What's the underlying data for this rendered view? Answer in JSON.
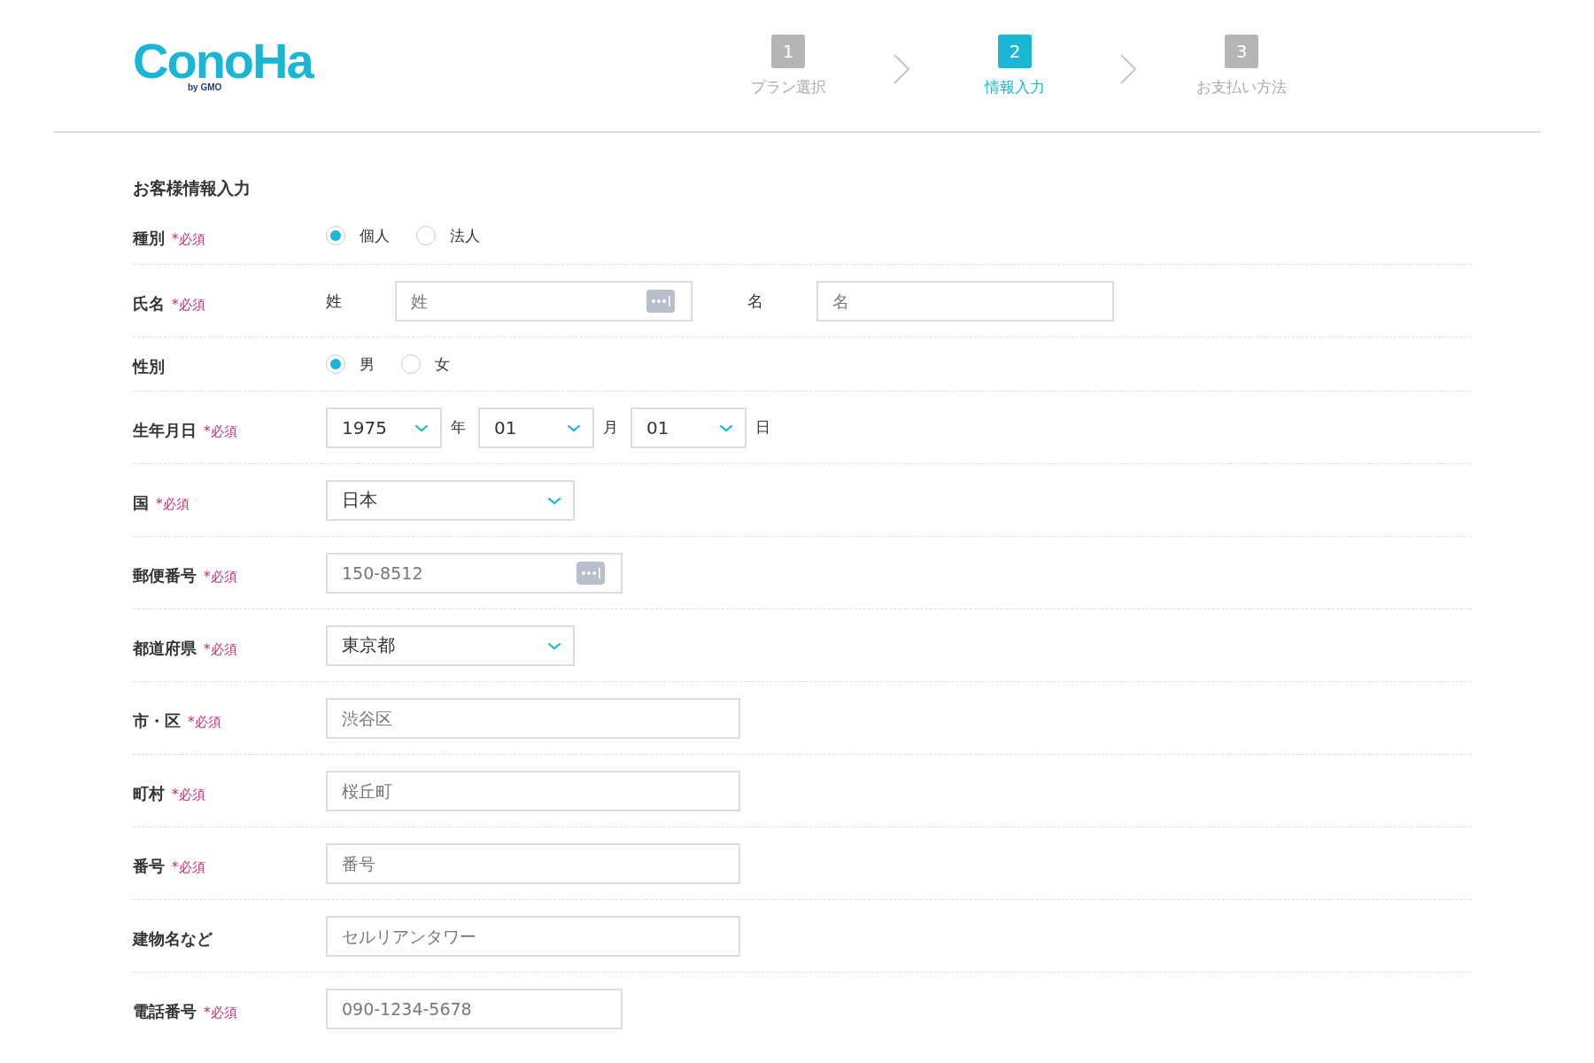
{
  "logo": {
    "name": "ConoHa",
    "sub": "by GMO"
  },
  "steps": [
    {
      "number": "1",
      "label": "プラン選択",
      "selected": false
    },
    {
      "number": "2",
      "label": "情報入力",
      "selected": true
    },
    {
      "number": "3",
      "label": "お支払い方法",
      "selected": false
    }
  ],
  "form": {
    "title": "お客様情報入力",
    "rows": [
      {
        "kind": "radio",
        "label": "種別",
        "required": "*必須",
        "options": [
          {
            "label": "個人",
            "selected": true
          },
          {
            "label": "法人",
            "selected": false
          }
        ]
      },
      {
        "kind": "name",
        "label": "氏名",
        "required": "*必須",
        "parts": [
          {
            "label": "姓",
            "placeholder": "姓",
            "autofill": true
          },
          {
            "label": "名",
            "placeholder": "名"
          }
        ]
      },
      {
        "kind": "radio",
        "label": "性別",
        "options": [
          {
            "label": "男",
            "selected": true
          },
          {
            "label": "女",
            "selected": false
          }
        ]
      },
      {
        "kind": "date",
        "label": "生年月日",
        "required": "*必須",
        "selects": [
          {
            "value": "1975",
            "unit": "年"
          },
          {
            "value": "01",
            "unit": "月"
          },
          {
            "value": "01",
            "unit": "日"
          }
        ]
      },
      {
        "kind": "select",
        "label": "国",
        "required": "*必須",
        "value": "日本"
      },
      {
        "kind": "postal",
        "label": "郵便番号",
        "required": "*必須",
        "placeholder": "150-8512",
        "autofill": true
      },
      {
        "kind": "select",
        "label": "都道府県",
        "required": "*必須",
        "value": "東京都"
      },
      {
        "kind": "text",
        "label": "市・区",
        "required": "*必須",
        "placeholder": "渋谷区"
      },
      {
        "kind": "text",
        "label": "町村",
        "required": "*必須",
        "placeholder": "桜丘町"
      },
      {
        "kind": "text",
        "label": "番号",
        "required": "*必須",
        "placeholder": "番号"
      },
      {
        "kind": "text",
        "label": "建物名など",
        "placeholder": "セルリアンタワー"
      },
      {
        "kind": "tel",
        "label": "電話番号",
        "required": "*必須",
        "placeholder": "090-1234-5678"
      }
    ]
  }
}
